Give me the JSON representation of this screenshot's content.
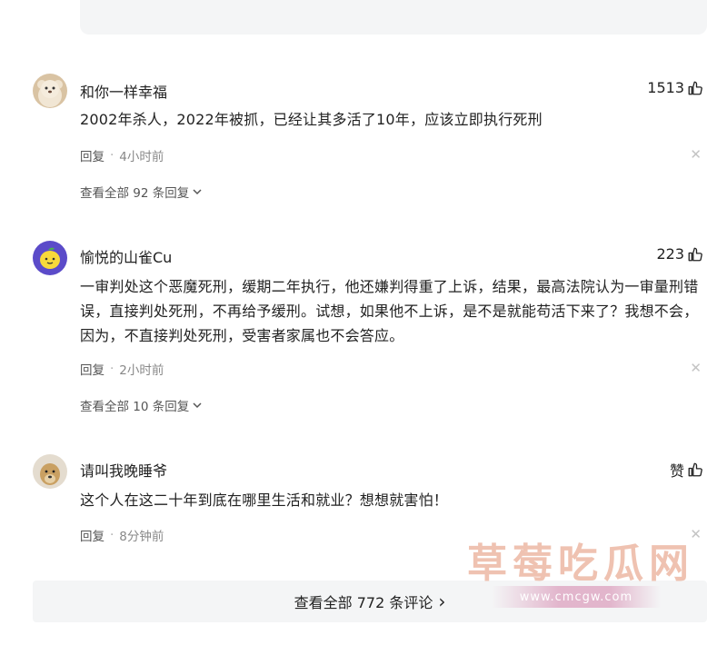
{
  "comments": [
    {
      "username": "和你一样幸福",
      "likes": "1513",
      "content": "2002年杀人，2022年被抓，已经让其多活了10年，应该立即执行死刑",
      "reply_label": "回复",
      "separator": "·",
      "time": "4小时前",
      "view_replies": "查看全部 92 条回复",
      "avatar_icon": "teddy-bear-avatar"
    },
    {
      "username": "愉悦的山雀Cu",
      "likes": "223",
      "content": "一审判处这个恶魔死刑，缓期二年执行，他还嫌判得重了上诉，结果，最高法院认为一审量刑错误，直接判处死刑，不再给予缓刑。试想，如果他不上诉，是不是就能苟活下来了？我想不会，因为，不直接判处死刑，受害者家属也不会答应。",
      "reply_label": "回复",
      "separator": "·",
      "time": "2小时前",
      "view_replies": "查看全部 10 条回复",
      "avatar_icon": "lemon-avatar"
    },
    {
      "username": "请叫我晚睡爷",
      "likes": "赞",
      "content": "这个人在这二十年到底在哪里生活和就业？想想就害怕！",
      "reply_label": "回复",
      "separator": "·",
      "time": "8分钟前",
      "avatar_icon": "dog-avatar"
    }
  ],
  "footer": {
    "view_all_label": "查看全部 772 条评论",
    "chevron": "›"
  },
  "watermark": {
    "main": "草莓吃瓜网",
    "url": "www.cmcgw.com"
  },
  "icons": {
    "like": "thumbs-up-icon",
    "close": "close-icon",
    "expand": "chevron-down-icon"
  },
  "colors": {
    "meta_gray": "#888888",
    "footer_bg": "#f4f5f6",
    "watermark": "#e28f71"
  }
}
